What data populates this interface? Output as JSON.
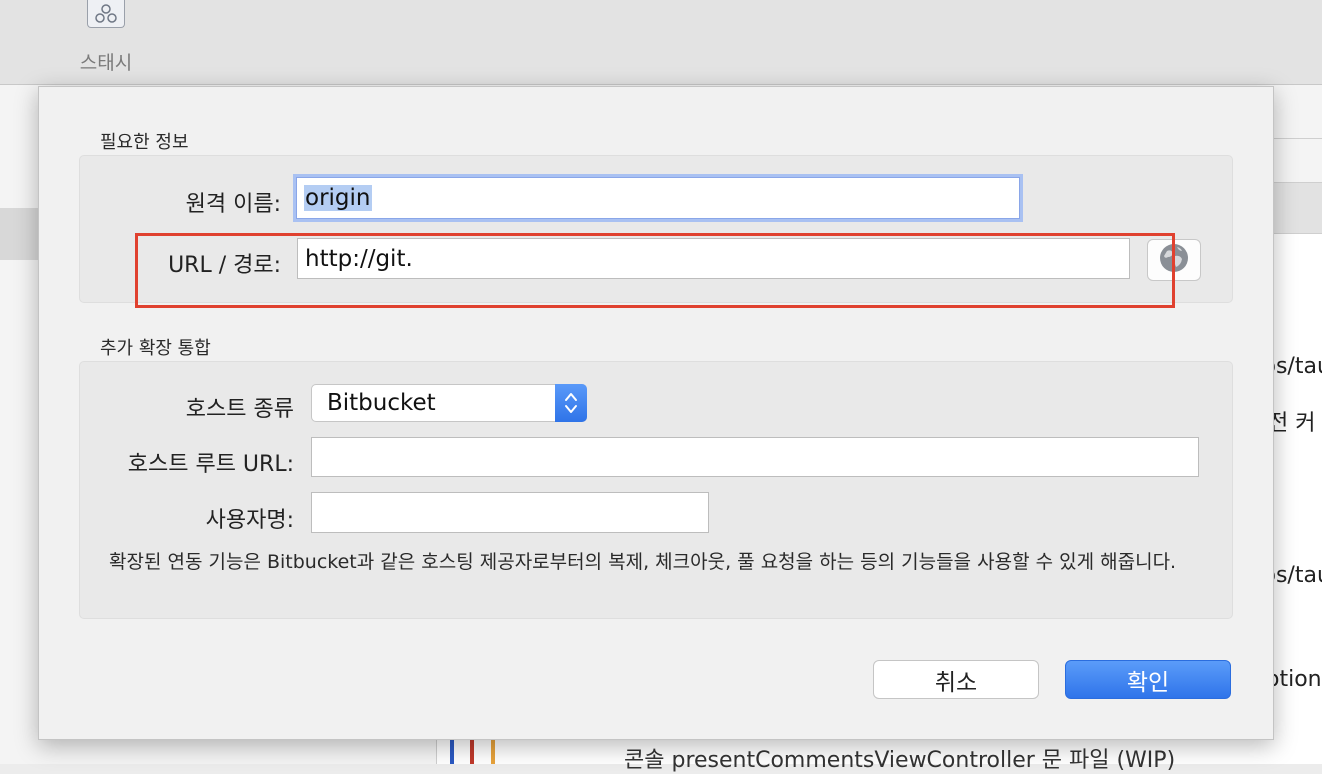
{
  "toolbar": {
    "stash_label": "스태시"
  },
  "background_snippets": {
    "line1": "ps/tau",
    "line2": "전 커",
    "line3": "ps/tau",
    "line4": "otion",
    "bottom": "콘솔 presentCommentsViewController 문 파일 (WIP)"
  },
  "dialog": {
    "required_section_title": "필요한 정보",
    "remote_name_label": "원격 이름:",
    "remote_name_value": "origin",
    "url_label": "URL / 경로:",
    "url_value": "http://git.",
    "extension_section_title": "추가 확장 통합",
    "host_type_label": "호스트 종류",
    "host_type_value": "Bitbucket",
    "host_root_url_label": "호스트 루트 URL:",
    "host_root_url_value": "",
    "username_label": "사용자명:",
    "username_value": "",
    "help_text": "확장된 연동 기능은 Bitbucket과 같은 호스팅 제공자로부터의 복제, 체크아웃, 풀 요청을 하는 등의 기능들을 사용할 수 있게 해줍니다.",
    "cancel_label": "취소",
    "ok_label": "확인"
  },
  "colors": {
    "accent": "#3478f6",
    "highlight_box": "#e0412f",
    "selection": "#b4cdf3"
  },
  "icons": {
    "stash": "stash-icon",
    "globe": "globe-icon",
    "stepper": "chevron-updown-icon"
  }
}
